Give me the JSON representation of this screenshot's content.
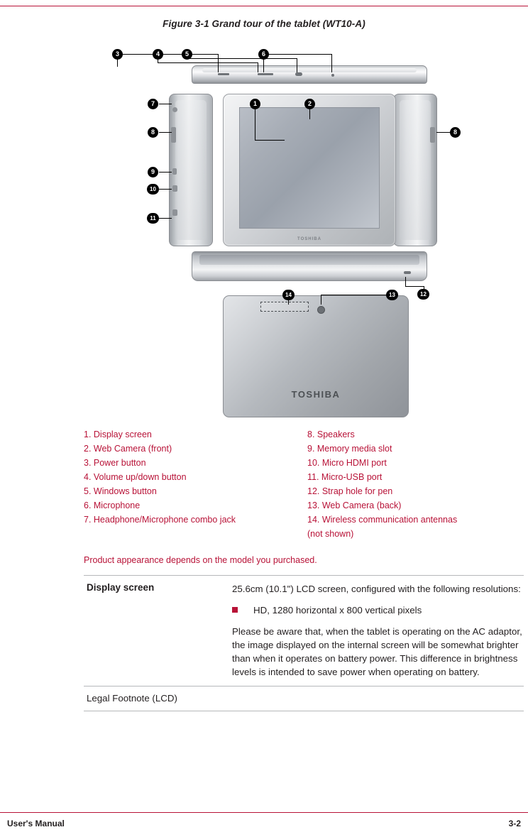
{
  "figure": {
    "caption": "Figure 3-1 Grand tour of the tablet (WT10-A)",
    "front_logo": "TOSHIBA",
    "back_logo": "TOSHIBA",
    "callouts": [
      {
        "n": "1"
      },
      {
        "n": "2"
      },
      {
        "n": "3"
      },
      {
        "n": "4"
      },
      {
        "n": "5"
      },
      {
        "n": "6"
      },
      {
        "n": "7"
      },
      {
        "n": "8"
      },
      {
        "n": "8b"
      },
      {
        "n": "9"
      },
      {
        "n": "10"
      },
      {
        "n": "11"
      },
      {
        "n": "12"
      },
      {
        "n": "13"
      },
      {
        "n": "14"
      }
    ],
    "marker_labels": {
      "1": "1",
      "2": "2",
      "3": "3",
      "4": "4",
      "5": "5",
      "6": "6",
      "7": "7",
      "8": "8",
      "8b": "8",
      "9": "9",
      "10": "10",
      "11": "11",
      "12": "12",
      "13": "13",
      "14": "14"
    }
  },
  "legend": {
    "left": [
      "1. Display screen",
      "2. Web Camera (front)",
      "3. Power button",
      "4. Volume up/down button",
      "5. Windows button",
      "6. Microphone",
      "7. Headphone/Microphone combo jack"
    ],
    "right": [
      "8. Speakers",
      "9. Memory media slot",
      "10. Micro HDMI port",
      "11. Micro-USB port",
      "12. Strap hole for pen",
      "13. Web Camera (back)",
      "14. Wireless communication antennas\n(not shown)"
    ]
  },
  "appearance_note": "Product appearance depends on the model you purchased.",
  "spec_table": {
    "rows": [
      {
        "label": "Display screen",
        "paragraph1": "25.6cm (10.1\") LCD screen, configured with the following resolutions:",
        "bullet1": "HD, 1280 horizontal x 800 vertical pixels",
        "paragraph2": "Please be aware that, when the tablet is operating on the AC adaptor, the image displayed on the internal screen will be somewhat brighter than when it operates on battery power. This difference in brightness levels is intended to save power when operating on battery."
      }
    ],
    "footnote": "Legal Footnote (LCD)"
  },
  "footer": {
    "left": "User's Manual",
    "right": "3-2"
  }
}
